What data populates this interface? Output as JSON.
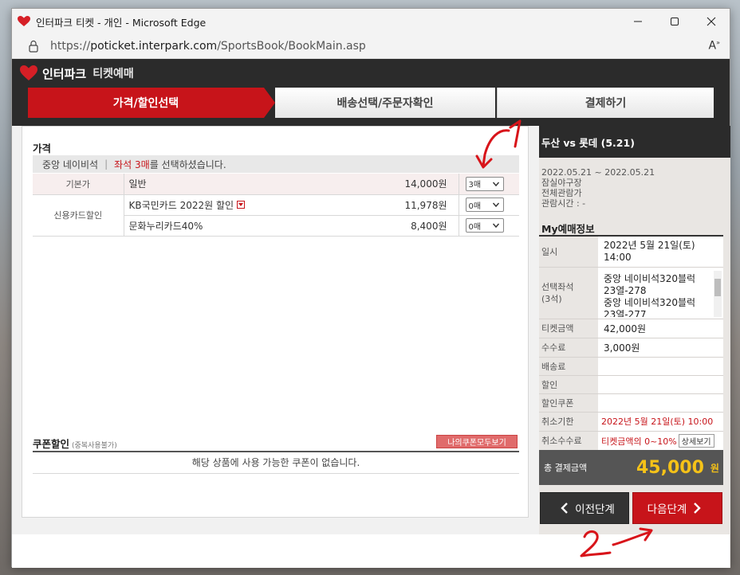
{
  "window": {
    "title": "인터파크 티켓 - 개인 - Microsoft Edge",
    "url_prefix": "https://",
    "url_host": "poticket.interpark.com",
    "url_path": "/SportsBook/BookMain.asp"
  },
  "brand": {
    "name": "인터파크",
    "sub": "티켓예매"
  },
  "steps": [
    "가격/할인선택",
    "배송선택/주문자확인",
    "결제하기"
  ],
  "price_section": {
    "title": "가격",
    "seat_grade": "중앙 네이비석",
    "seat_prefix": "좌석 3매",
    "seat_suffix": "를 선택하셨습니다.",
    "rows": [
      {
        "category": "기본가",
        "name": "일반",
        "price": "14,000원",
        "qty": "3매"
      },
      {
        "category": "신용카드할인",
        "name": "KB국민카드 2022원 할인",
        "price": "11,978원",
        "qty": "0매"
      },
      {
        "category": "",
        "name": "문화누리카드40%",
        "price": "8,400원",
        "qty": "0매"
      }
    ]
  },
  "coupon": {
    "title": "쿠폰할인",
    "note": "(중복사용불가)",
    "button": "나의쿠폰모두보기",
    "empty": "해당 상품에 사용 가능한 쿠폰이 없습니다."
  },
  "game": {
    "title": "두산 vs 롯데 (5.21)",
    "period": "2022.05.21 ~ 2022.05.21",
    "venue": "잠실야구장",
    "age": "전체관람가",
    "runtime": "관람시간 : -"
  },
  "my_booking": {
    "title": "My예매정보",
    "date_label": "일시",
    "date_value": "2022년 5월 21일(토)",
    "time_value": "14:00",
    "seat_label_1": "선택좌석",
    "seat_label_2": "(3석)",
    "seats": [
      "중앙 네이비석320블럭",
      "23열-278",
      "중앙 네이비석320블럭",
      "23열-277"
    ],
    "ticket_label": "티켓금액",
    "ticket_value": "42,000원",
    "fee_label": "수수료",
    "fee_value": "3,000원",
    "delivery_label": "배송료",
    "discount_label": "할인",
    "coupon_label": "할인쿠폰",
    "cancel_deadline_label": "취소기한",
    "cancel_deadline_value": "2022년 5월 21일(토) 10:00",
    "cancel_fee_label": "취소수수료",
    "cancel_fee_value": "티켓금액의 0~10%",
    "detail_button": "상세보기",
    "total_label": "총 결제금액",
    "total_value": "45,000",
    "total_unit": "원"
  },
  "nav": {
    "prev": "이전단계",
    "next": "다음단계"
  },
  "colors": {
    "accent": "#c7141a",
    "dark": "#2b2b2b",
    "total": "#f5c218"
  }
}
